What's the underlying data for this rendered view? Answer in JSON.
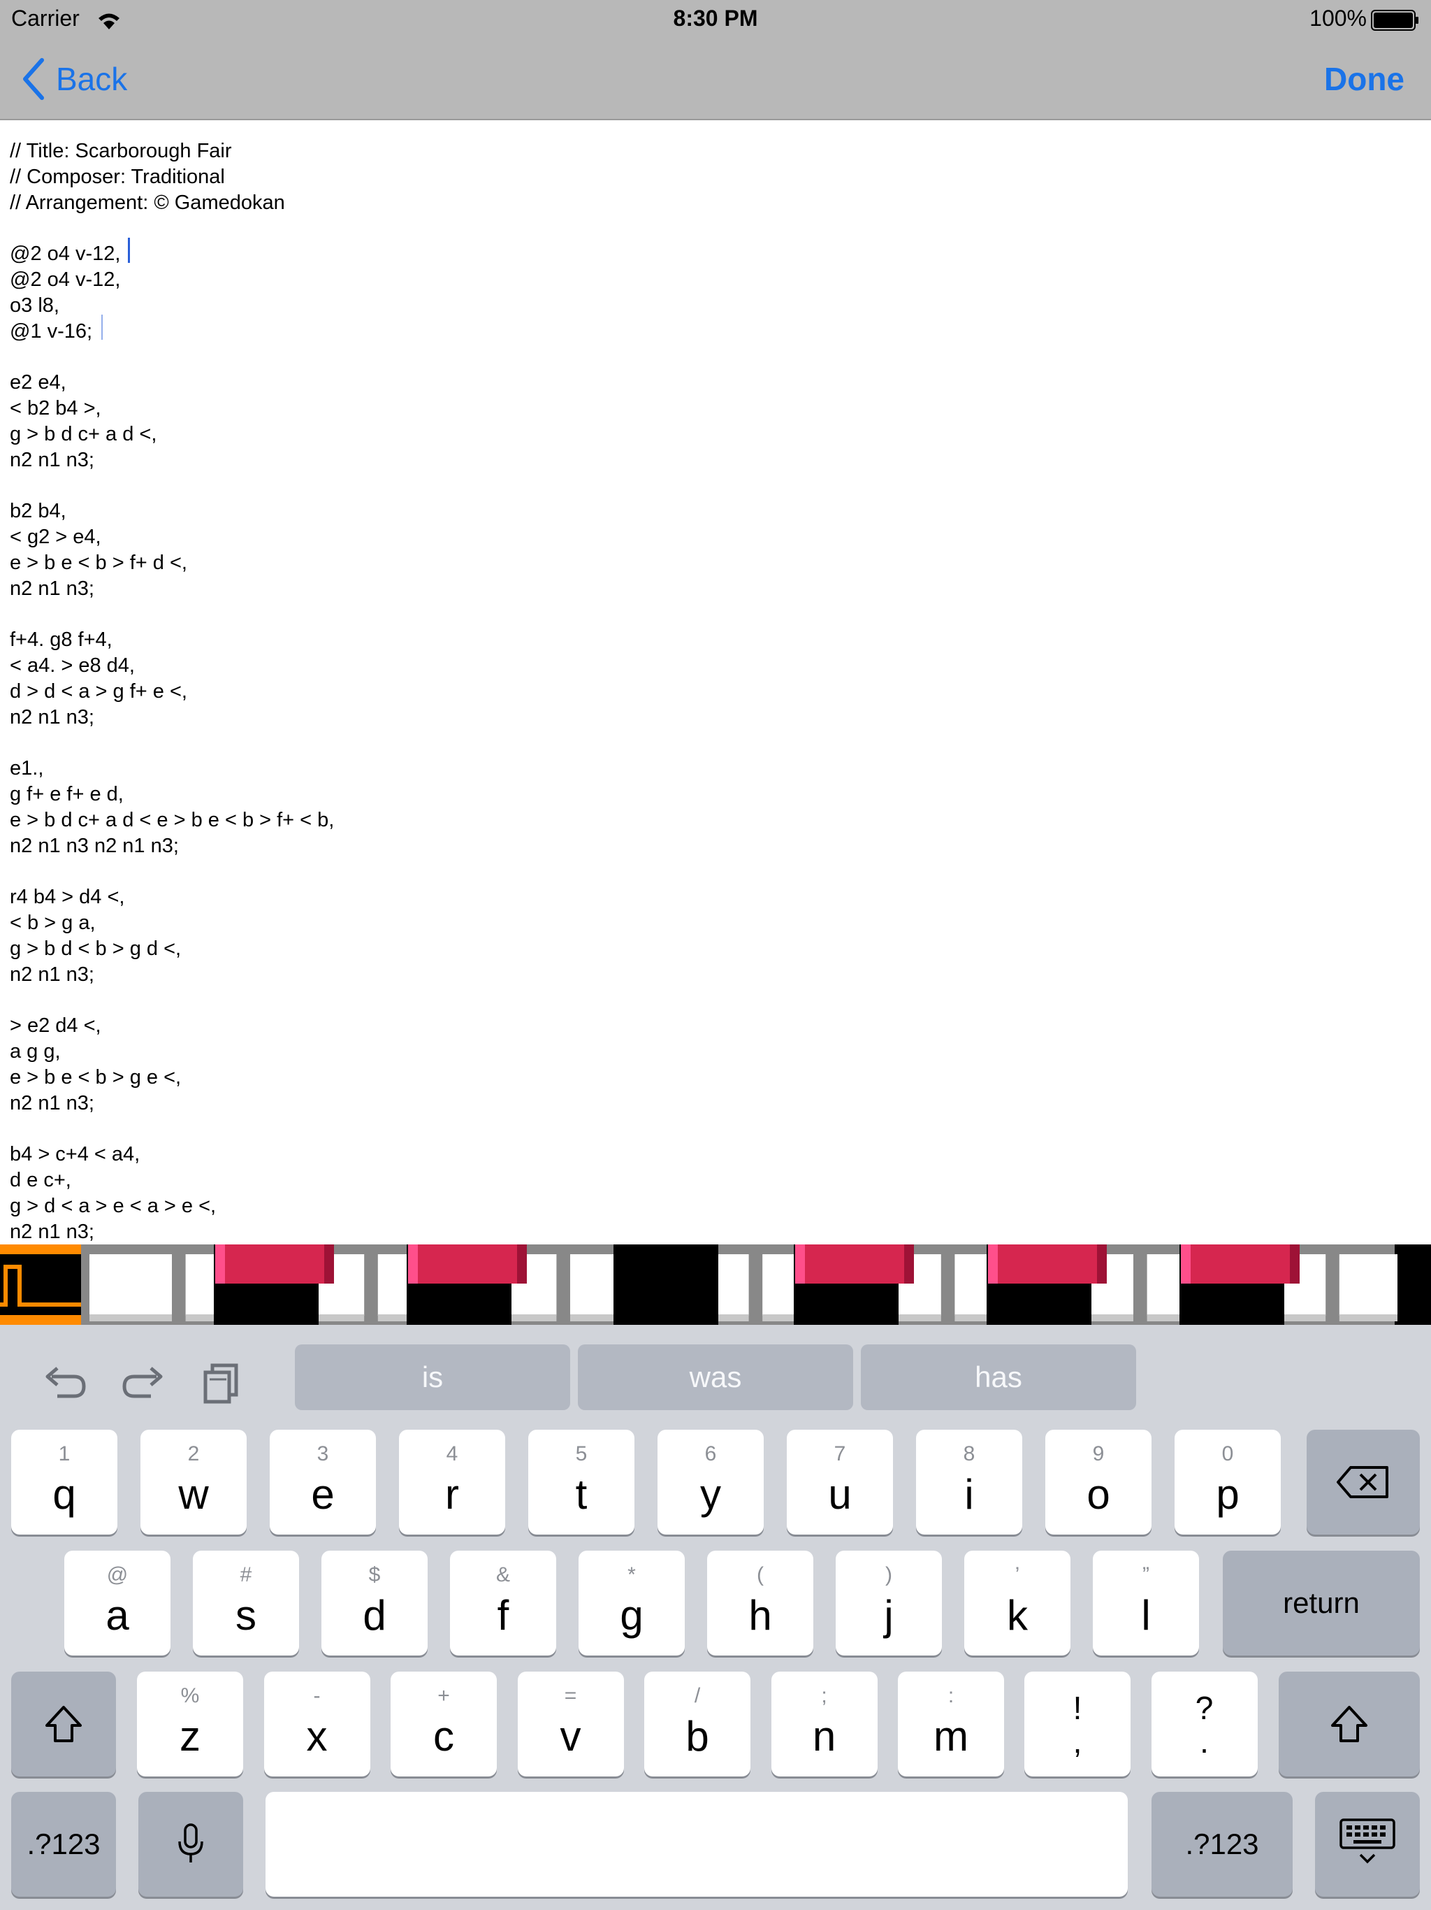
{
  "status_bar": {
    "carrier": "Carrier",
    "time": "8:30 PM",
    "battery": "100%"
  },
  "nav": {
    "back_label": "Back",
    "done_label": "Done"
  },
  "editor": {
    "lines": [
      "// Title: Scarborough Fair",
      "// Composer: Traditional",
      "// Arrangement: © Gamedokan",
      "",
      "@2 o4 v-12,",
      "@2 o4 v-12,",
      "o3 l8,",
      "@1 v-16;",
      "",
      "e2 e4,",
      "< b2 b4 >,",
      "g > b d c+ a d <,",
      "n2 n1 n3;",
      "",
      "b2 b4,",
      "< g2 > e4,",
      "e > b e < b > f+ d <,",
      "n2 n1 n3;",
      "",
      "f+4. g8 f+4,",
      "< a4. > e8 d4,",
      "d > d < a > g f+ e <,",
      "n2 n1 n3;",
      "",
      "e1.,",
      "g f+ e f+ e d,",
      "e > b d c+ a d < e > b e < b > f+ < b,",
      "n2 n1 n3 n2 n1 n3;",
      "",
      "r4 b4 > d4 <,",
      "< b > g a,",
      "g > b d < b > g d <,",
      "n2 n1 n3;",
      "",
      "> e2 d4 <,",
      "a g g,",
      "e > b e < b > g e <,",
      "n2 n1 n3;",
      "",
      "b4 > c+4 < a4,",
      "d e c+,",
      "g > d < a > e < a > e <,",
      "n2 n1 n3;"
    ]
  },
  "keyboard": {
    "suggestions": [
      "is",
      "was",
      "has"
    ],
    "row1": [
      {
        "alt": "1",
        "main": "q"
      },
      {
        "alt": "2",
        "main": "w"
      },
      {
        "alt": "3",
        "main": "e"
      },
      {
        "alt": "4",
        "main": "r"
      },
      {
        "alt": "5",
        "main": "t"
      },
      {
        "alt": "6",
        "main": "y"
      },
      {
        "alt": "7",
        "main": "u"
      },
      {
        "alt": "8",
        "main": "i"
      },
      {
        "alt": "9",
        "main": "o"
      },
      {
        "alt": "0",
        "main": "p"
      }
    ],
    "row2": [
      {
        "alt": "@",
        "main": "a"
      },
      {
        "alt": "#",
        "main": "s"
      },
      {
        "alt": "$",
        "main": "d"
      },
      {
        "alt": "&",
        "main": "f"
      },
      {
        "alt": "*",
        "main": "g"
      },
      {
        "alt": "(",
        "main": "h"
      },
      {
        "alt": ")",
        "main": "j"
      },
      {
        "alt": "’",
        "main": "k"
      },
      {
        "alt": "”",
        "main": "l"
      }
    ],
    "row3": [
      {
        "alt": "%",
        "main": "z"
      },
      {
        "alt": "-",
        "main": "x"
      },
      {
        "alt": "+",
        "main": "c"
      },
      {
        "alt": "=",
        "main": "v"
      },
      {
        "alt": "/",
        "main": "b"
      },
      {
        "alt": ";",
        "main": "n"
      },
      {
        "alt": ":",
        "main": "m"
      }
    ],
    "row3_punct": [
      {
        "top": "!",
        "bottom": ","
      },
      {
        "top": "?",
        "bottom": "."
      }
    ],
    "return_label": "return",
    "numbers_label": ".?123",
    "icons": {
      "undo": "undo-icon",
      "redo": "redo-icon",
      "paste": "clipboard-icon",
      "delete": "backspace-icon",
      "shift": "shift-icon",
      "mic": "microphone-icon",
      "hide": "keyboard-dismiss-icon"
    }
  },
  "colors": {
    "tint": "#1a73e8",
    "bar_bg": "#b8b8b8",
    "keyboard_bg": "#d1d4da",
    "piano_highlight": "#d6264f",
    "wave_orange": "#ff8a00"
  }
}
